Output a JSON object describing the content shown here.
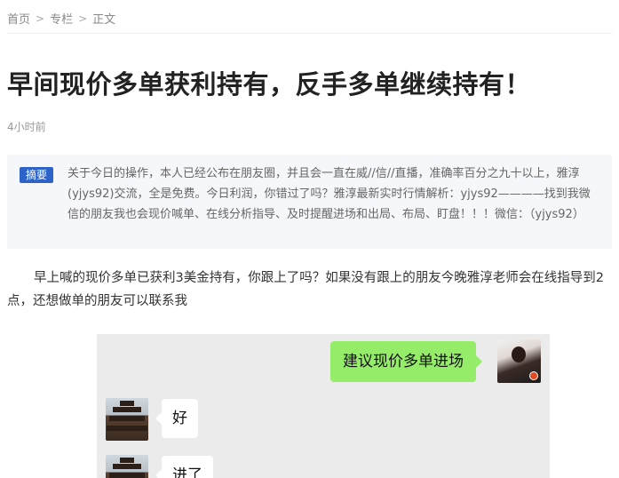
{
  "breadcrumb": {
    "home": "首页",
    "column": "专栏",
    "current": "正文",
    "separator": ">"
  },
  "article": {
    "title": "早间现价多单获利持有，反手多单继续持有！",
    "time": "4小时前",
    "summary_badge": "摘要",
    "summary_text": "关于今日的操作，本人已经公布在朋友圈，并且会一直在威//信//直播，准确率百分之九十以上，雅淳(yjys92)交流，全是免费。今日利润，你错过了吗？雅淳最新实时行情解析：yjys92————找到我微信的朋友我也会现价喊单、在线分析指导、及时提醒进场和出局、布局、盯盘！！！微信：（yjys92）",
    "paragraph": "早上喊的现价多单已获利3美金持有，你跟上了吗？如果没有跟上的朋友今晚雅淳老师会在线指导到2点，还想做单的朋友可以联系我"
  },
  "chat": {
    "messages": [
      {
        "side": "right",
        "text": "建议现价多单进场"
      },
      {
        "side": "left",
        "text": "好"
      },
      {
        "side": "left",
        "text": "进了"
      }
    ]
  },
  "colors": {
    "badge": "#2d63c8",
    "summary_bg": "#f5f7fa",
    "chat_bg": "#ebebeb",
    "bubble_green": "#95ec69"
  }
}
